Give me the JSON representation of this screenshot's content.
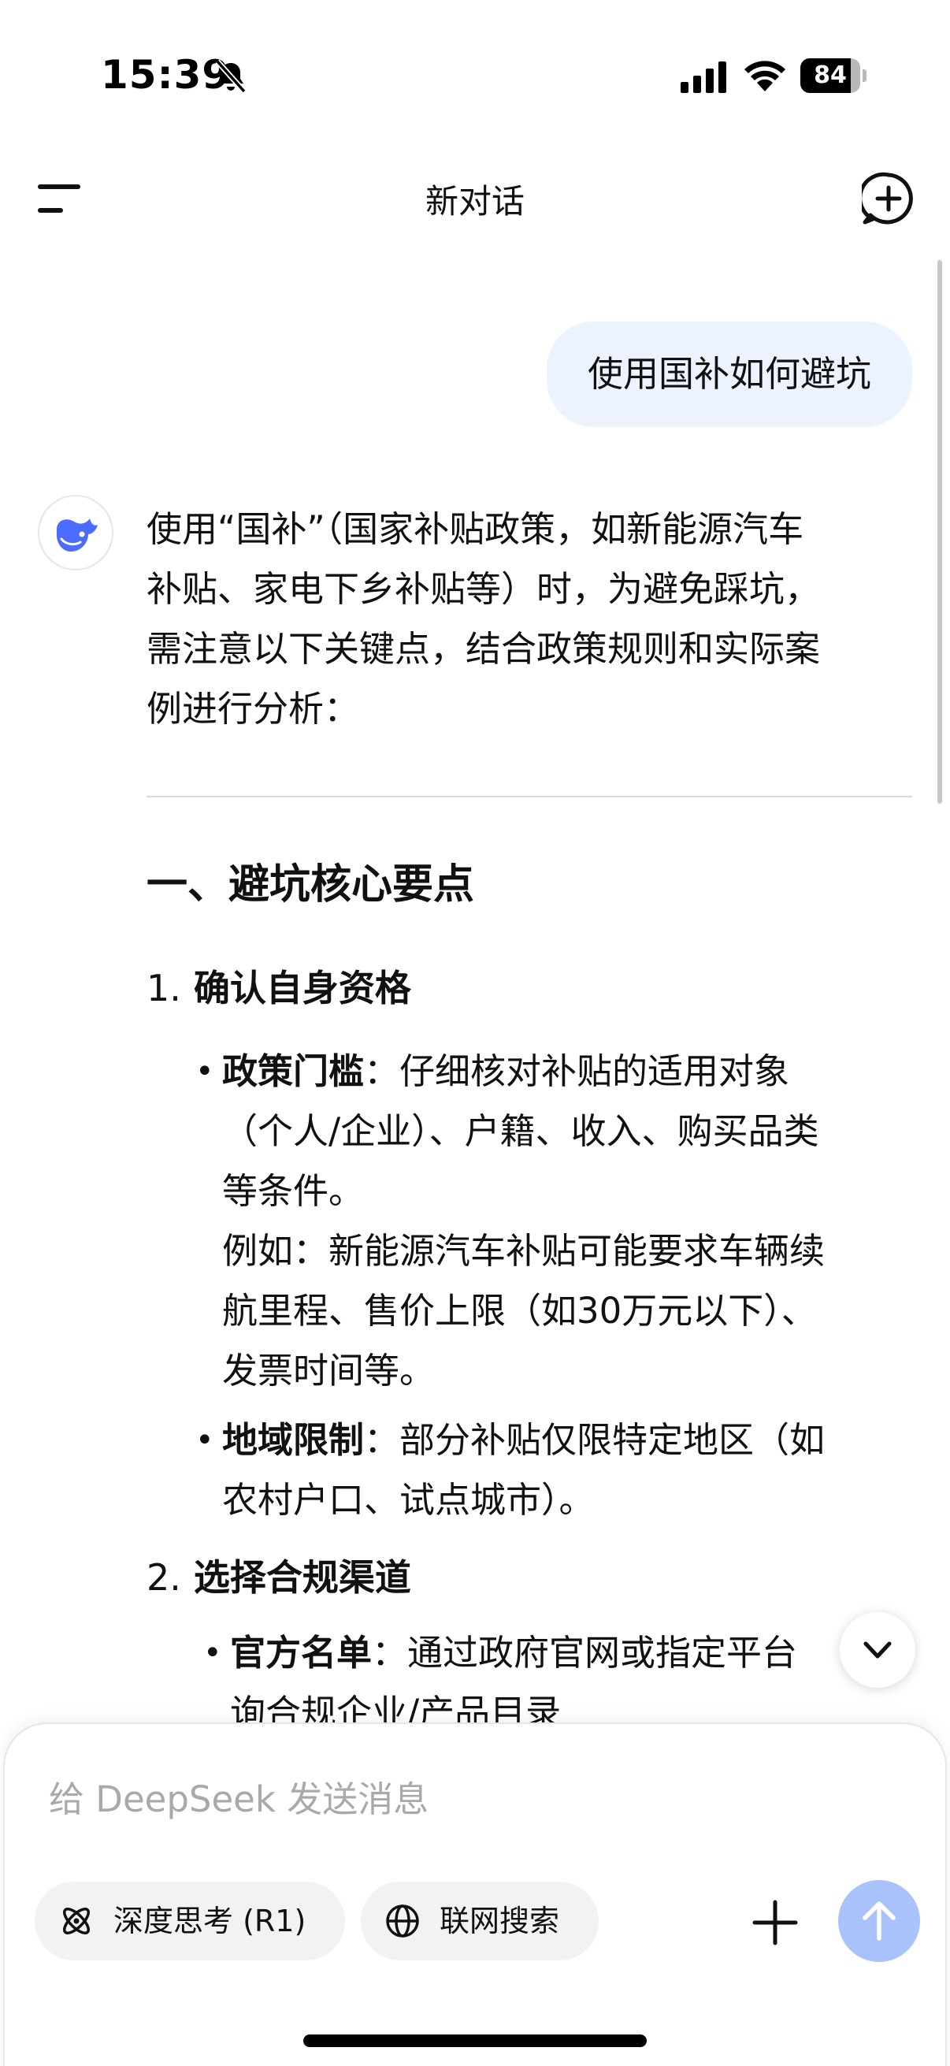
{
  "status_bar": {
    "time": "15:39",
    "battery": "84",
    "battery_level": 84
  },
  "header": {
    "title": "新对话"
  },
  "user_message": "使用国补如何避坑",
  "answer": {
    "intro": "使用“国补”（国家补贴政策，如新能源汽车\n补贴、家电下乡补贴等）时，为避免踩坑，\n需注意以下关键点，结合政策规则和实际案\n例进行分析：",
    "section_title": "一、避坑核心要点",
    "items": [
      {
        "number": "1.",
        "title": "确认自身资格",
        "bullets": [
          {
            "label": "政策门槛",
            "text": "：仔细核对补贴的适用对象\n（个人/企业）、户籍、收入、购买品类\n等条件。\n例如：新能源汽车补贴可能要求车辆续\n航里程、售价上限（如30万元以下）、\n发票时间等。"
          },
          {
            "label": "地域限制",
            "text": "：部分补贴仅限特定地区（如\n农村户口、试点城市）。"
          }
        ]
      },
      {
        "number": "2.",
        "title": "选择合规渠道",
        "bullets": [
          {
            "label": "官方名单",
            "text": "：通过政府官网或指定平台\n询合规企业/产品目录"
          }
        ]
      }
    ]
  },
  "composer": {
    "placeholder": "给 DeepSeek 发送消息",
    "deep_think_label": "深度思考 (R1)",
    "web_search_label": "联网搜索"
  },
  "colors": {
    "accent": "#4d6bfe",
    "bubble": "#edf3fe",
    "send_disabled": "#a9c2fb"
  }
}
